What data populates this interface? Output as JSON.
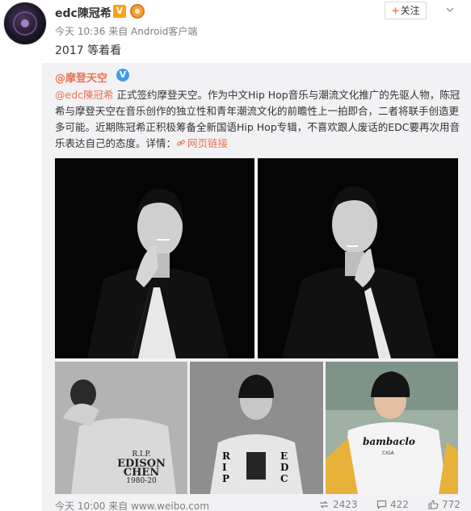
{
  "header": {
    "username": "edc陳冠希",
    "vip_label": "V",
    "follow_label": "+关注",
    "meta": "今天 10:36 来自 Android客户端",
    "post_text": "2017 等着看"
  },
  "repost": {
    "author": "@摩登天空",
    "verified_label": "V",
    "mention": "@edc陳冠希",
    "body": " 正式签约摩登天空。作为中文Hip Hop音乐与潮流文化推广的先驱人物，陈冠希与摩登天空在音乐创作的独立性和青年潮流文化的前瞻性上一拍即合，二者将联手创造更多可能。近期陈冠希正积极筹备全新国语Hip Hop专辑，不喜欢跟人废话的EDC要再次用音乐表达自己的态度。详情：",
    "link_label": "网页链接",
    "photos": {
      "p3_text": [
        "R.I.P.",
        "EDISON",
        "CHEN",
        "1980-20"
      ],
      "p4_text": [
        "R",
        "I",
        "P",
        "E",
        "D",
        "C"
      ],
      "p5_text": [
        "bambaclo",
        "CIGA"
      ]
    },
    "footer": {
      "meta": "今天 10:00 来自 www.weibo.com",
      "reposts": "2423",
      "comments": "422",
      "likes": "772"
    }
  },
  "colors": {
    "accent": "#eb7350",
    "verified_blue": "#3c9cf0",
    "repost_bg": "#f2f2f5"
  }
}
